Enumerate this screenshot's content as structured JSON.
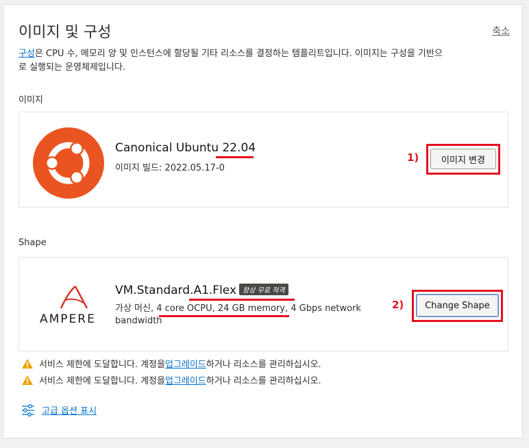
{
  "header": {
    "title": "이미지 및 구성",
    "collapse_label": "축소"
  },
  "intro": {
    "link_text": "구성",
    "text_line1": "은 CPU 수, 메모리 양 및 인스턴스에 할당될 기타 리소스를 결정하는 템플리트입니다. 이미지는 구성을 기반으",
    "text_line2": "로 실행되는 운영체제입니다."
  },
  "image_section": {
    "label": "이미지",
    "name": "Canonical Ubuntu 22.04",
    "build": "이미지 빌드: 2022.05.17-0",
    "change_button": "이미지 변경",
    "annotation": "1)",
    "logo_color": "#e95420"
  },
  "shape_section": {
    "label": "Shape",
    "logo_text": "AMPERE",
    "name": "VM.Standard.A1.Flex",
    "badge": "항상 무료 적격",
    "desc_line1": "가상 머신, 4 core OCPU, 24 GB memory, 4 Gbps network",
    "desc_line2": "bandwidth",
    "change_button": "Change Shape",
    "annotation": "2)",
    "logo_color": "#d6352a"
  },
  "warnings": [
    {
      "prefix": "서비스 제한에 도달합니다. 계정을 ",
      "link": "업그레이드",
      "suffix": "하거나 리소스를 관리하십시오."
    },
    {
      "prefix": "서비스 제한에 도달합니다. 계정을 ",
      "link": "업그레이드",
      "suffix": "하거나 리소스를 관리하십시오."
    }
  ],
  "advanced": {
    "label": "고급 옵션 표시"
  },
  "colors": {
    "annotation_red": "#e4101f",
    "link_blue": "#0572ce",
    "warning_yellow": "#f0a30a"
  }
}
